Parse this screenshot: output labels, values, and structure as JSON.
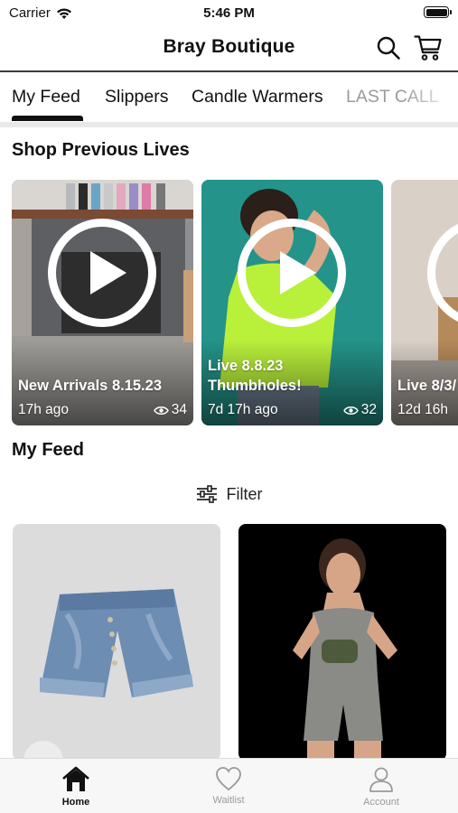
{
  "status_bar": {
    "carrier": "Carrier",
    "time": "5:46 PM"
  },
  "header": {
    "title": "Bray Boutique"
  },
  "tabs": [
    {
      "label": "My Feed",
      "active": true
    },
    {
      "label": "Slippers",
      "active": false
    },
    {
      "label": "Candle Warmers",
      "active": false
    },
    {
      "label": "LAST CALL",
      "active": false
    }
  ],
  "previous_lives": {
    "title": "Shop Previous Lives",
    "cards": [
      {
        "title": "New Arrivals 8.15.23",
        "time": "17h ago",
        "views": "34"
      },
      {
        "title": "Live 8.8.23\nThumbholes!",
        "time": "7d 17h ago",
        "views": "32"
      },
      {
        "title": "Live 8/3/",
        "time": "12d 16h",
        "views": ""
      }
    ]
  },
  "feed": {
    "title": "My Feed",
    "filter_label": "Filter"
  },
  "bottom_nav": {
    "items": [
      {
        "label": "Home",
        "icon": "home-icon",
        "active": true
      },
      {
        "label": "Waitlist",
        "icon": "heart-icon",
        "active": false
      },
      {
        "label": "Account",
        "icon": "person-icon",
        "active": false
      }
    ]
  },
  "colors": {
    "accent": "#111111",
    "inactive": "#9a9a9a",
    "tab_divider": "#e9e9e9"
  }
}
